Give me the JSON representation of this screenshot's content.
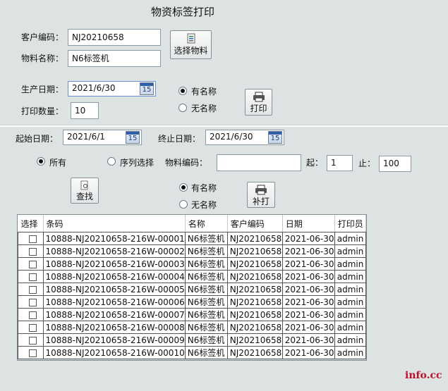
{
  "form": {
    "title": "物资标签打印",
    "customer_code_label": "客户编码：",
    "customer_code_value": "NJ20210658",
    "material_name_label": "物料名称：",
    "material_name_value": "N6标签机",
    "select_material_button": "选择物料",
    "production_date_label": "生产日期：",
    "production_date_value": "2021/6/30",
    "print_qty_label": "打印数量：",
    "print_qty_value": "10",
    "named_option": "有名称",
    "unnamed_option": "无名称",
    "print_button": "打印"
  },
  "query": {
    "start_date_label": "起始日期：",
    "start_date_value": "2021/6/1",
    "end_date_label": "终止日期：",
    "end_date_value": "2021/6/30",
    "all_option": "所有",
    "sequence_option": "序列选择",
    "material_code_label": "物料编码：",
    "material_code_value": "",
    "from_label": "起：",
    "from_value": "1",
    "to_label": "止：",
    "to_value": "100",
    "search_button": "查找",
    "named_option": "有名称",
    "unnamed_option": "无名称",
    "reprint_button": "补打"
  },
  "calendar_icon_text": "15",
  "table": {
    "columns": [
      "选择",
      "条码",
      "名称",
      "客户编码",
      "日期",
      "打印员"
    ],
    "rows": [
      {
        "barcode": "10888-NJ20210658-216W-00001",
        "name": "N6标签机",
        "customer": "NJ20210658",
        "date": "2021-06-30",
        "operator": "admin"
      },
      {
        "barcode": "10888-NJ20210658-216W-00002",
        "name": "N6标签机",
        "customer": "NJ20210658",
        "date": "2021-06-30",
        "operator": "admin"
      },
      {
        "barcode": "10888-NJ20210658-216W-00003",
        "name": "N6标签机",
        "customer": "NJ20210658",
        "date": "2021-06-30",
        "operator": "admin"
      },
      {
        "barcode": "10888-NJ20210658-216W-00004",
        "name": "N6标签机",
        "customer": "NJ20210658",
        "date": "2021-06-30",
        "operator": "admin"
      },
      {
        "barcode": "10888-NJ20210658-216W-00005",
        "name": "N6标签机",
        "customer": "NJ20210658",
        "date": "2021-06-30",
        "operator": "admin"
      },
      {
        "barcode": "10888-NJ20210658-216W-00006",
        "name": "N6标签机",
        "customer": "NJ20210658",
        "date": "2021-06-30",
        "operator": "admin"
      },
      {
        "barcode": "10888-NJ20210658-216W-00007",
        "name": "N6标签机",
        "customer": "NJ20210658",
        "date": "2021-06-30",
        "operator": "admin"
      },
      {
        "barcode": "10888-NJ20210658-216W-00008",
        "name": "N6标签机",
        "customer": "NJ20210658",
        "date": "2021-06-30",
        "operator": "admin"
      },
      {
        "barcode": "10888-NJ20210658-216W-00009",
        "name": "N6标签机",
        "customer": "NJ20210658",
        "date": "2021-06-30",
        "operator": "admin"
      },
      {
        "barcode": "10888-NJ20210658-216W-00010",
        "name": "N6标签机",
        "customer": "NJ20210658",
        "date": "2021-06-30",
        "operator": "admin"
      }
    ]
  },
  "watermark": "info.cc",
  "icons": {
    "select_material": "material-list-icon",
    "print": "printer-icon",
    "search": "document-search-icon",
    "reprint": "printer-icon",
    "calendar": "calendar-icon"
  }
}
